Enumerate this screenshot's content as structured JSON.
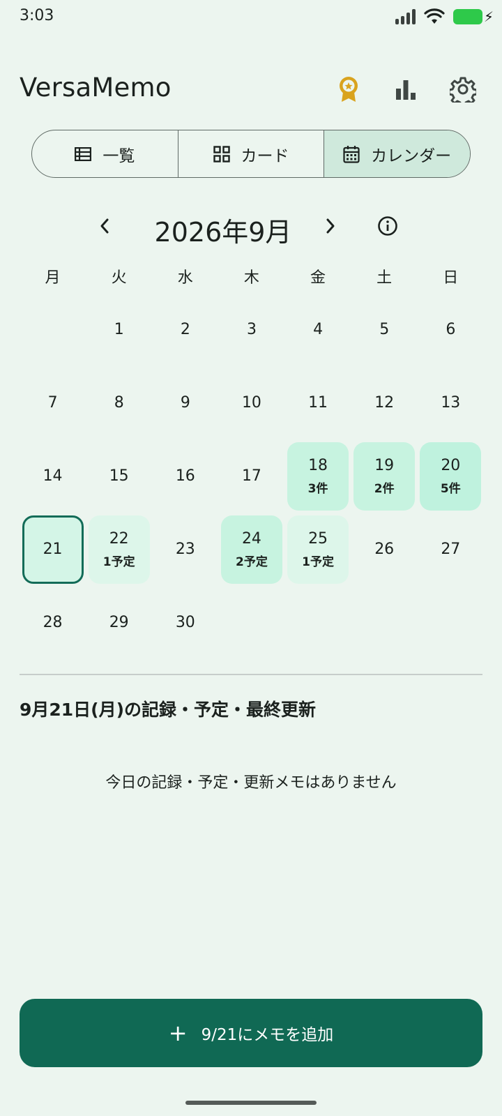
{
  "status_bar": {
    "time": "3:03"
  },
  "app": {
    "title": "VersaMemo",
    "accent": "#106954",
    "badge_color": "#d9a31e"
  },
  "header_icons": [
    "award-icon",
    "bar-chart-icon",
    "gear-icon"
  ],
  "view_tabs": [
    {
      "label": "一覧",
      "icon": "list-icon",
      "active": false
    },
    {
      "label": "カード",
      "icon": "grid-icon",
      "active": false
    },
    {
      "label": "カレンダー",
      "icon": "calendar-icon",
      "active": true
    }
  ],
  "calendar": {
    "month_title": "2026年9月",
    "weekdays": [
      "月",
      "火",
      "水",
      "木",
      "金",
      "土",
      "日"
    ],
    "weeks": [
      [
        null,
        {
          "day": "1"
        },
        {
          "day": "2"
        },
        {
          "day": "3"
        },
        {
          "day": "4"
        },
        {
          "day": "5"
        },
        {
          "day": "6"
        }
      ],
      [
        {
          "day": "7"
        },
        {
          "day": "8"
        },
        {
          "day": "9"
        },
        {
          "day": "10"
        },
        {
          "day": "11"
        },
        {
          "day": "12"
        },
        {
          "day": "13"
        }
      ],
      [
        {
          "day": "14"
        },
        {
          "day": "15"
        },
        {
          "day": "16"
        },
        {
          "day": "17"
        },
        {
          "day": "18",
          "label": "3件",
          "level": 2
        },
        {
          "day": "19",
          "label": "2件",
          "level": 2
        },
        {
          "day": "20",
          "label": "5件",
          "level": 3
        }
      ],
      [
        {
          "day": "21",
          "selected": true
        },
        {
          "day": "22",
          "label": "1予定",
          "level": 1
        },
        {
          "day": "23"
        },
        {
          "day": "24",
          "label": "2予定",
          "level": 2
        },
        {
          "day": "25",
          "label": "1予定",
          "level": 1
        },
        {
          "day": "26"
        },
        {
          "day": "27"
        }
      ],
      [
        {
          "day": "28"
        },
        {
          "day": "29"
        },
        {
          "day": "30"
        },
        null,
        null,
        null,
        null
      ]
    ]
  },
  "detail": {
    "title": "9月21日(月)の記録・予定・最終更新",
    "empty_message": "今日の記録・予定・更新メモはありません"
  },
  "add_button": {
    "label": "9/21にメモを追加"
  }
}
